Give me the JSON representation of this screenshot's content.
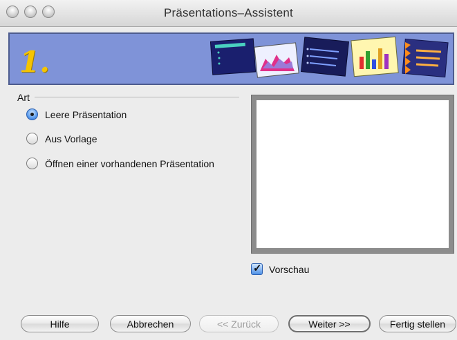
{
  "window": {
    "title": "Präsentations–Assistent"
  },
  "banner": {
    "step": "1."
  },
  "section": {
    "label": "Art"
  },
  "options": [
    {
      "label": "Leere Präsentation",
      "selected": true
    },
    {
      "label": "Aus Vorlage",
      "selected": false
    },
    {
      "label": "Öffnen einer vorhandenen Präsentation",
      "selected": false
    }
  ],
  "preview": {
    "checkbox_label": "Vorschau",
    "checked": true
  },
  "buttons": {
    "help": "Hilfe",
    "cancel": "Abbrechen",
    "back": "<< Zurück",
    "next": "Weiter >>",
    "finish": "Fertig stellen"
  },
  "colors": {
    "banner_bg": "#7f93d8",
    "step_number": "#f5c400"
  }
}
